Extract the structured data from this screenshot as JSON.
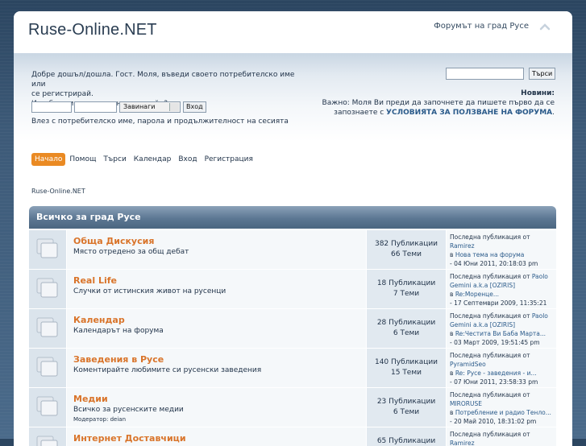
{
  "header": {
    "site_title": "Ruse-Online.NET",
    "slogan": "Форумът на град Русе",
    "collapse_icon": "chevron-up-icon"
  },
  "userbar": {
    "welcome_line1": "Добре дошъл/дошла. Гост. Моля, въведи своето потребителско име или",
    "welcome_line2": "се регистрирай.",
    "welcome_line3": "Изгубил си активационния е-мейл?",
    "duration_value": "Завинаги",
    "login_button": "Вход",
    "session_note": "Влез с потребителско име, парола и продължителност на сесията",
    "search_button": "Търси",
    "news_title": "Новини:",
    "news_line1": "Важно: Моля Ви преди да започнете да пишете първо да се",
    "news_line2_prefix": "запознаете с",
    "news_link": "УСЛОВИЯТА ЗА ПОЛЗВАНЕ НА ФОРУМА",
    "news_line2_suffix": "."
  },
  "menu": {
    "items": [
      "Начало",
      "Помощ",
      "Търси",
      "Календар",
      "Вход",
      "Регистрация"
    ],
    "active_index": 0
  },
  "breadcrumb": "Ruse-Online.NET",
  "category": {
    "title": "Всичко за град Русе",
    "boards": [
      {
        "name": "Обща Дискусия",
        "description": "Място отредено за общ дебат",
        "moderator": "",
        "posts": "382 Публикации",
        "topics": "66 Теми",
        "last_label": "Последна публикация",
        "last_by_prefix": "от",
        "last_by": "Ramirez",
        "last_in_prefix": "в",
        "last_topic": "Нова тема на форума",
        "last_date": "- 04 Юни 2011, 20:18:03 pm"
      },
      {
        "name": "Real Life",
        "description": "Случки от истинския живот на русенци",
        "moderator": "",
        "posts": "18 Публикации",
        "topics": "7 Теми",
        "last_label": "Последна публикация",
        "last_by_prefix": "от",
        "last_by": "Paolo Gemini a.k.a [OZIRIS]",
        "last_in_prefix": "в",
        "last_topic": "Re:Моренце...",
        "last_date": "- 17 Септември 2009, 11:35:21 am"
      },
      {
        "name": "Календар",
        "description": "Календарът на форума",
        "moderator": "",
        "posts": "28 Публикации",
        "topics": "6 Теми",
        "last_label": "Последна публикация",
        "last_by_prefix": "от",
        "last_by": "Paolo Gemini a.k.a [OZIRIS]",
        "last_in_prefix": "в",
        "last_topic": "Re:Честита Ви Баба Марта...",
        "last_date": "- 03 Март 2009, 19:51:45 pm"
      },
      {
        "name": "Заведения в Русе",
        "description": "Коментирайте любимите си русенски заведения",
        "moderator": "",
        "posts": "140 Публикации",
        "topics": "15 Теми",
        "last_label": "Последна публикация",
        "last_by_prefix": "от",
        "last_by": "PyramidSeo",
        "last_in_prefix": "в",
        "last_topic": "Re: Русе - заведения - и...",
        "last_date": "- 07 Юни 2011, 23:58:33 pm"
      },
      {
        "name": "Медии",
        "description": "Всичко за русенските медии",
        "moderator": "Модератор: deian",
        "posts": "23 Публикации",
        "topics": "6 Теми",
        "last_label": "Последна публикация",
        "last_by_prefix": "от",
        "last_by": "MIRORUSE",
        "last_in_prefix": "в",
        "last_topic": "Потребление и радио Тенло...",
        "last_date": "- 20 Май 2010, 18:31:02 pm"
      },
      {
        "name": "Интернет Доставчици",
        "description": "",
        "moderator": "",
        "posts": "65 Публикации",
        "topics": "",
        "last_label": "Последна публикация",
        "last_by_prefix": "от",
        "last_by": "Ramirez",
        "last_in_prefix": "",
        "last_topic": "",
        "last_date": ""
      }
    ]
  }
}
